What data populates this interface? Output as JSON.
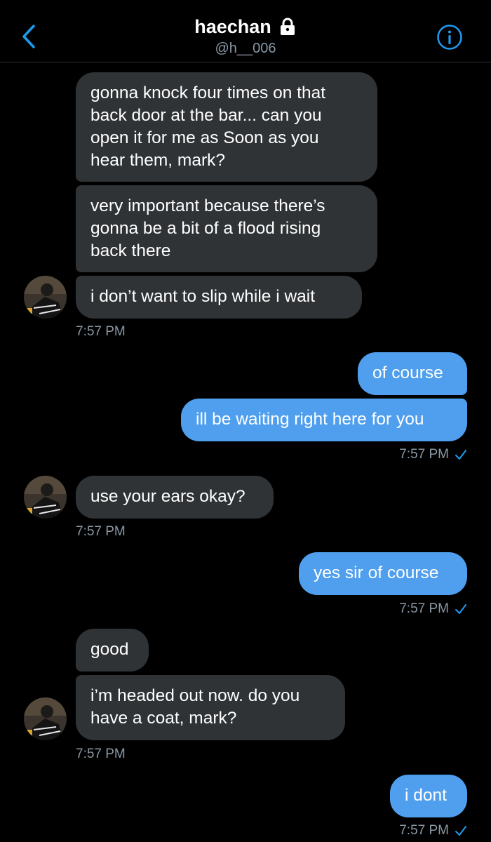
{
  "header": {
    "title": "haechan",
    "handle": "@h__006"
  },
  "messages": [
    {
      "text": "gonna knock four times on that\nback door at the bar... can you\nopen it for me as Soon as you\nhear them, mark?"
    },
    {
      "text": "very important because there’s\ngonna be a bit of a flood rising\nback there"
    },
    {
      "text": "i don’t want to slip while i wait"
    },
    {
      "time": "7:57 PM"
    },
    {
      "text": "of course"
    },
    {
      "text": "ill be waiting right here for you"
    },
    {
      "time": "7:57 PM"
    },
    {
      "text": "use your ears okay?"
    },
    {
      "time": "7:57 PM"
    },
    {
      "text": "yes sir of course"
    },
    {
      "time": "7:57 PM"
    },
    {
      "text": "good"
    },
    {
      "text": "i’m headed out now. do you\nhave a coat, mark?"
    },
    {
      "time": "7:57 PM"
    },
    {
      "text": "i dont"
    },
    {
      "time": "7:57 PM"
    }
  ],
  "colors": {
    "background": "#000000",
    "received_bubble": "#2f3336",
    "sent_bubble": "#4f9fee",
    "accent": "#1d9bf0",
    "muted_text": "#8b98a5"
  },
  "icons": {
    "back": "chevron-left-icon",
    "lock": "lock-icon",
    "info": "info-icon",
    "read_receipt": "check-icon"
  }
}
